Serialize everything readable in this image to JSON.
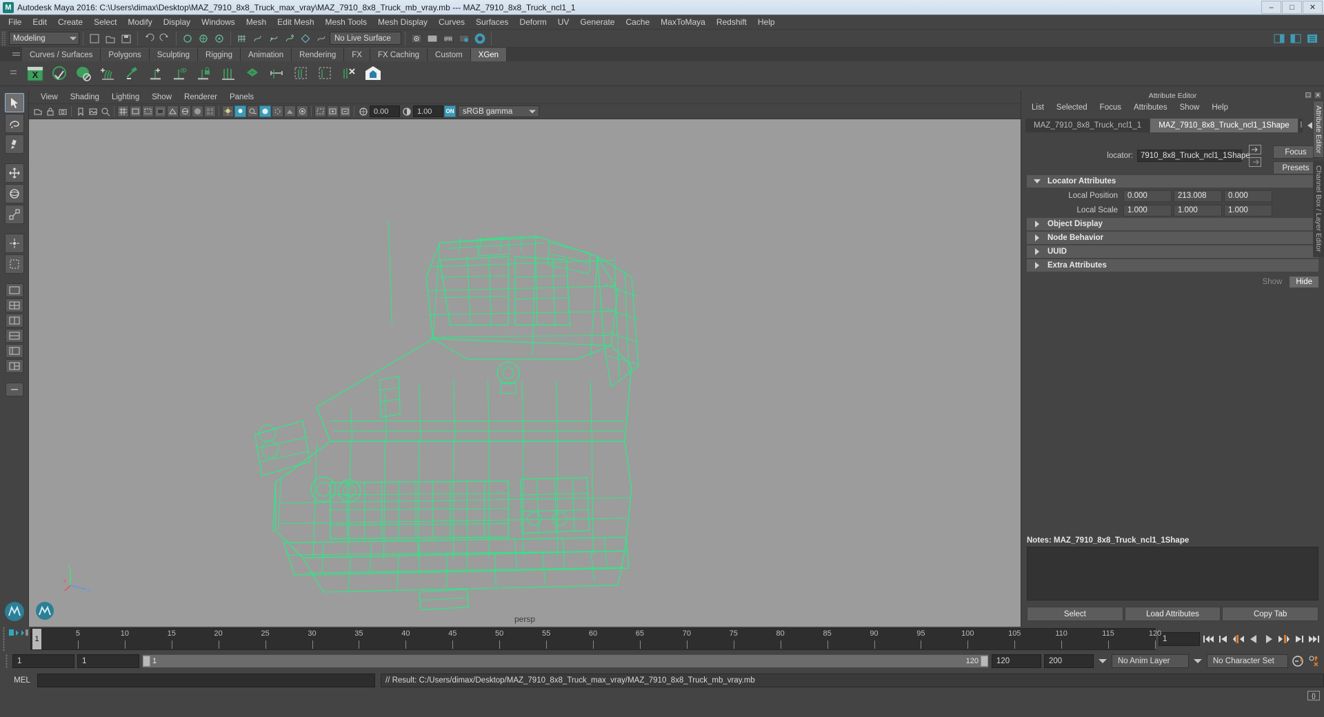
{
  "window": {
    "title": "Autodesk Maya 2016: C:\\Users\\dimax\\Desktop\\MAZ_7910_8x8_Truck_max_vray\\MAZ_7910_8x8_Truck_mb_vray.mb   ---   MAZ_7910_8x8_Truck_ncl1_1",
    "minimize": "–",
    "maximize": "□",
    "close": "✕",
    "app_icon": "maya-icon"
  },
  "menubar": {
    "items": [
      "File",
      "Edit",
      "Create",
      "Select",
      "Modify",
      "Display",
      "Windows",
      "Mesh",
      "Edit Mesh",
      "Mesh Tools",
      "Mesh Display",
      "Curves",
      "Surfaces",
      "Deform",
      "UV",
      "Generate",
      "Cache",
      "MaxToMaya",
      "Redshift",
      "Help"
    ]
  },
  "statusline": {
    "mode": "Modeling",
    "live_surface": "No Live Surface"
  },
  "shelf": {
    "tabs": [
      "Curves / Surfaces",
      "Polygons",
      "Sculpting",
      "Rigging",
      "Animation",
      "Rendering",
      "FX",
      "FX Caching",
      "Custom",
      "XGen"
    ],
    "active_tab": "XGen"
  },
  "panel": {
    "menu": [
      "View",
      "Shading",
      "Lighting",
      "Show",
      "Renderer",
      "Panels"
    ],
    "exposure": "0.00",
    "gamma_value": "1.00",
    "color_mgmt_toggle": "ON",
    "color_profile": "sRGB gamma",
    "camera_label": "persp",
    "axis": {
      "x": "x",
      "y": "y",
      "z": "z"
    }
  },
  "attribute_editor": {
    "title": "Attribute Editor",
    "menu": [
      "List",
      "Selected",
      "Focus",
      "Attributes",
      "Show",
      "Help"
    ],
    "tabs": [
      {
        "label": "MAZ_7910_8x8_Truck_ncl1_1",
        "active": false
      },
      {
        "label": "MAZ_7910_8x8_Truck_ncl1_1Shape",
        "active": true
      },
      {
        "label": "la",
        "active": false
      }
    ],
    "locator_label": "locator:",
    "locator_value": "7910_8x8_Truck_ncl1_1Shape",
    "focus_button": "Focus",
    "presets_button": "Presets",
    "show_button": "Show",
    "hide_button": "Hide",
    "sections": [
      {
        "name": "Locator Attributes",
        "expanded": true
      },
      {
        "name": "Object Display",
        "expanded": false
      },
      {
        "name": "Node Behavior",
        "expanded": false
      },
      {
        "name": "UUID",
        "expanded": false
      },
      {
        "name": "Extra Attributes",
        "expanded": false
      }
    ],
    "locator_attributes": [
      {
        "label": "Local Position",
        "values": [
          "0.000",
          "213.008",
          "0.000"
        ]
      },
      {
        "label": "Local Scale",
        "values": [
          "1.000",
          "1.000",
          "1.000"
        ]
      }
    ],
    "notes_label": "Notes:",
    "notes_value": "MAZ_7910_8x8_Truck_ncl1_1Shape",
    "notes_text": "",
    "footer_buttons": [
      "Select",
      "Load Attributes",
      "Copy Tab"
    ],
    "vertical_tabs": [
      "Attribute Editor",
      "Channel Box / Layer Editor"
    ],
    "window_buttons": [
      "▣",
      "✕"
    ]
  },
  "timeline": {
    "ticks": [
      5,
      10,
      15,
      20,
      25,
      30,
      35,
      40,
      45,
      50,
      55,
      60,
      65,
      70,
      75,
      80,
      85,
      90,
      95,
      100,
      105,
      110,
      115,
      120
    ],
    "current_frame": "1",
    "current_frame_field": "1",
    "range_start": "1",
    "range_end": "1",
    "slider_min": "1",
    "slider_max": "120",
    "playback_end": "120",
    "anim_end": "200",
    "anim_layer": "No Anim Layer",
    "character_set": "No Character Set"
  },
  "command_line": {
    "language": "MEL",
    "input": "",
    "output": "// Result: C:/Users/dimax/Desktop/MAZ_7910_8x8_Truck_max_vray/MAZ_7910_8x8_Truck_mb_vray.mb"
  },
  "colors": {
    "wireframe_green": "#2dea86",
    "viewport_bg": "#9c9c9c",
    "accent_teal": "#3f9ab5",
    "panel_bg": "#444444",
    "field_bg": "#2d2d2d"
  }
}
